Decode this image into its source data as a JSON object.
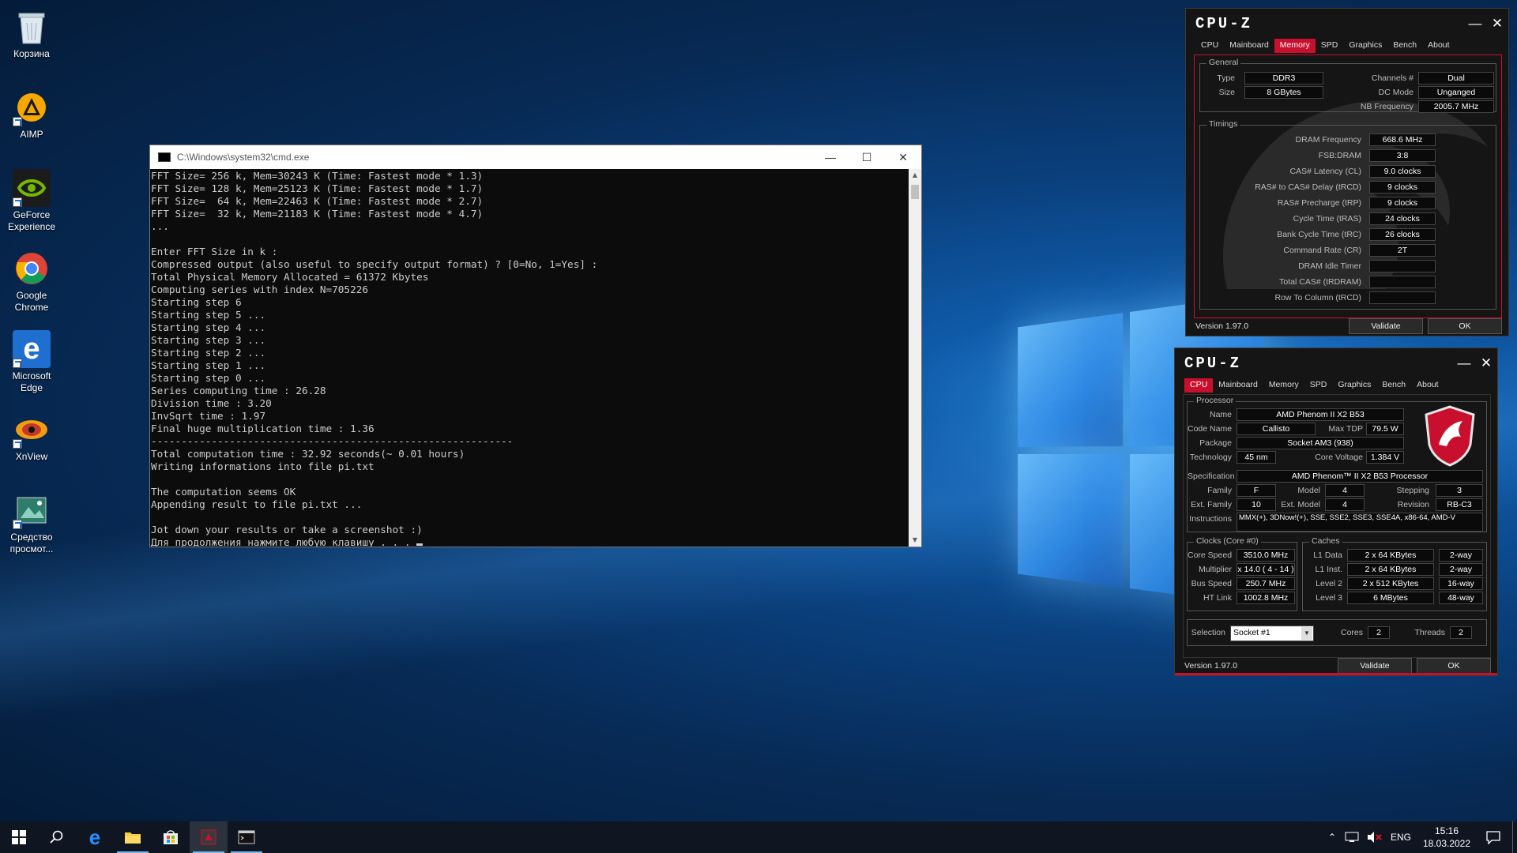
{
  "desktop": {
    "icons": [
      {
        "label": "Корзина",
        "icon": "recycle-bin-icon"
      },
      {
        "label": "AIMP",
        "icon": "aimp-icon"
      },
      {
        "label": "GeForce Experience",
        "icon": "geforce-icon"
      },
      {
        "label": "Google Chrome",
        "icon": "chrome-icon"
      },
      {
        "label": "Microsoft Edge",
        "icon": "edge-icon"
      },
      {
        "label": "XnView",
        "icon": "xnview-icon"
      },
      {
        "label": "Средство просмот...",
        "icon": "photo-viewer-icon"
      }
    ]
  },
  "cmd": {
    "title": "C:\\Windows\\system32\\cmd.exe",
    "lines": [
      "FFT Size= 256 k, Mem=30243 K (Time: Fastest mode * 1.3)",
      "FFT Size= 128 k, Mem=25123 K (Time: Fastest mode * 1.7)",
      "FFT Size=  64 k, Mem=22463 K (Time: Fastest mode * 2.7)",
      "FFT Size=  32 k, Mem=21183 K (Time: Fastest mode * 4.7)",
      "...",
      "",
      "Enter FFT Size in k :",
      "Compressed output (also useful to specify output format) ? [0=No, 1=Yes] :",
      "Total Physical Memory Allocated = 61372 Kbytes",
      "Computing series with index N=705226",
      "Starting step 6",
      "Starting step 5 ...",
      "Starting step 4 ...",
      "Starting step 3 ...",
      "Starting step 2 ...",
      "Starting step 1 ...",
      "Starting step 0 ...",
      "Series computing time : 26.28",
      "Division time : 3.20",
      "InvSqrt time : 1.97",
      "Final huge multiplication time : 1.36",
      "------------------------------------------------------------",
      "Total computation time : 32.92 seconds(~ 0.01 hours)",
      "Writing informations into file pi.txt",
      "",
      "The computation seems OK",
      "Appending result to file pi.txt ...",
      "",
      "Jot down your results or take a screenshot :)",
      "Для продолжения нажмите любую клавишу . . ."
    ]
  },
  "cpuz_memory": {
    "logo": "CPU-Z",
    "tabs": [
      "CPU",
      "Mainboard",
      "Memory",
      "SPD",
      "Graphics",
      "Bench",
      "About"
    ],
    "active_tab": "Memory",
    "general_title": "General",
    "type_label": "Type",
    "type": "DDR3",
    "size_label": "Size",
    "size": "8 GBytes",
    "channels_label": "Channels #",
    "channels": "Dual",
    "dcmode_label": "DC Mode",
    "dcmode": "Unganged",
    "nbfreq_label": "NB Frequency",
    "nbfreq": "2005.7 MHz",
    "timings_title": "Timings",
    "timings": [
      {
        "label": "DRAM Frequency",
        "value": "668.6 MHz"
      },
      {
        "label": "FSB:DRAM",
        "value": "3:8"
      },
      {
        "label": "CAS# Latency (CL)",
        "value": "9.0 clocks"
      },
      {
        "label": "RAS# to CAS# Delay (tRCD)",
        "value": "9 clocks"
      },
      {
        "label": "RAS# Precharge (tRP)",
        "value": "9 clocks"
      },
      {
        "label": "Cycle Time (tRAS)",
        "value": "24 clocks"
      },
      {
        "label": "Bank Cycle Time (tRC)",
        "value": "26 clocks"
      },
      {
        "label": "Command Rate (CR)",
        "value": "2T"
      },
      {
        "label": "DRAM Idle Timer",
        "value": ""
      },
      {
        "label": "Total CAS# (tRDRAM)",
        "value": ""
      },
      {
        "label": "Row To Column (tRCD)",
        "value": ""
      }
    ],
    "version": "Version 1.97.0",
    "validate": "Validate",
    "ok": "OK"
  },
  "cpuz_cpu": {
    "logo": "CPU-Z",
    "tabs": [
      "CPU",
      "Mainboard",
      "Memory",
      "SPD",
      "Graphics",
      "Bench",
      "About"
    ],
    "active_tab": "CPU",
    "processor_title": "Processor",
    "name_label": "Name",
    "name": "AMD Phenom II X2 B53",
    "codename_label": "Code Name",
    "codename": "Callisto",
    "maxtdp_label": "Max TDP",
    "maxtdp": "79.5 W",
    "package_label": "Package",
    "package": "Socket AM3 (938)",
    "tech_label": "Technology",
    "tech": "45 nm",
    "corevolt_label": "Core Voltage",
    "corevolt": "1.384 V",
    "spec_label": "Specification",
    "spec": "AMD Phenom™ II X2 B53 Processor",
    "family_label": "Family",
    "family": "F",
    "model_label": "Model",
    "model": "4",
    "stepping_label": "Stepping",
    "stepping": "3",
    "extfamily_label": "Ext. Family",
    "extfamily": "10",
    "extmodel_label": "Ext. Model",
    "extmodel": "4",
    "revision_label": "Revision",
    "revision": "RB-C3",
    "instr_label": "Instructions",
    "instr": "MMX(+), 3DNow!(+), SSE, SSE2, SSE3, SSE4A, x86-64, AMD-V",
    "clocks_title": "Clocks (Core #0)",
    "corespeed_label": "Core Speed",
    "corespeed": "3510.0 MHz",
    "mult_label": "Multiplier",
    "mult": "x 14.0 ( 4 - 14 )",
    "bus_label": "Bus Speed",
    "bus": "250.7 MHz",
    "ht_label": "HT Link",
    "ht": "1002.8 MHz",
    "caches_title": "Caches",
    "caches": [
      {
        "label": "L1 Data",
        "size": "2 x 64 KBytes",
        "way": "2-way"
      },
      {
        "label": "L1 Inst.",
        "size": "2 x 64 KBytes",
        "way": "2-way"
      },
      {
        "label": "Level 2",
        "size": "2 x 512 KBytes",
        "way": "16-way"
      },
      {
        "label": "Level 3",
        "size": "6 MBytes",
        "way": "48-way"
      }
    ],
    "selection_label": "Selection",
    "selection": "Socket #1",
    "cores_label": "Cores",
    "cores": "2",
    "threads_label": "Threads",
    "threads": "2",
    "version": "Version 1.97.0",
    "validate": "Validate",
    "ok": "OK"
  },
  "taskbar": {
    "lang": "ENG",
    "time": "15:16",
    "date": "18.03.2022"
  },
  "colors": {
    "accent": "#c8102e",
    "taskbar": "#10161f"
  }
}
